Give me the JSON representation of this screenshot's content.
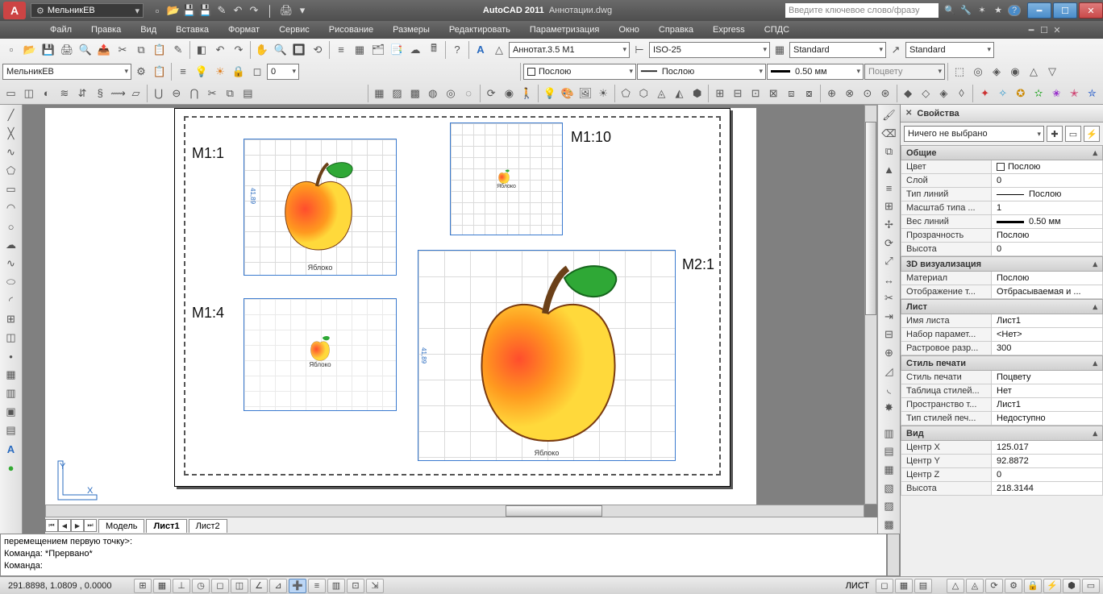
{
  "app": {
    "name": "AutoCAD 2011",
    "doc": "Аннотации.dwg",
    "workspace": "МельникЕВ",
    "search_placeholder": "Введите ключевое слово/фразу"
  },
  "menu": [
    "Файл",
    "Правка",
    "Вид",
    "Вставка",
    "Формат",
    "Сервис",
    "Рисование",
    "Размеры",
    "Редактировать",
    "Параметризация",
    "Окно",
    "Справка",
    "Express",
    "СПДС"
  ],
  "row1": {
    "layer_combo": "МельникЕВ",
    "layerstate": "0",
    "textstyle": "Аннотат.3.5 М1",
    "dimstyle": "ISO-25",
    "tablestyle": "Standard",
    "mleaderstyle": "Standard"
  },
  "row2": {
    "color": "Послою",
    "ltype": "Послою",
    "lweight": "0.50 мм",
    "plotstyle": "Поцвету"
  },
  "tabs": {
    "model": "Модель",
    "l1": "Лист1",
    "l2": "Лист2"
  },
  "scales": {
    "s1": "М1:1",
    "s2": "М1:10",
    "s3": "М1:4",
    "s4": "М2:1"
  },
  "vplabel": "Яблоко",
  "dimtext": "41,89",
  "cmd": {
    "line1": "перемещением первую точку>:",
    "line2": "Команда: *Прервано*",
    "line3": "Команда:"
  },
  "status": {
    "coords": "291.8898, 1.0809 , 0.0000",
    "layout": "ЛИСТ"
  },
  "props": {
    "title": "Свойства",
    "selection": "Ничего не выбрано",
    "groups": {
      "general": {
        "title": "Общие",
        "rows": [
          [
            "Цвет",
            "Послою"
          ],
          [
            "Слой",
            "0"
          ],
          [
            "Тип линий",
            "Послою"
          ],
          [
            "Масштаб типа ...",
            "1"
          ],
          [
            "Вес линий",
            "0.50 мм"
          ],
          [
            "Прозрачность",
            "Послою"
          ],
          [
            "Высота",
            "0"
          ]
        ]
      },
      "viz": {
        "title": "3D визуализация",
        "rows": [
          [
            "Материал",
            "Послою"
          ],
          [
            "Отображение т...",
            "Отбрасываемая и ..."
          ]
        ]
      },
      "sheet": {
        "title": "Лист",
        "rows": [
          [
            "Имя листа",
            "Лист1"
          ],
          [
            "Набор парамет...",
            "<Нет>"
          ],
          [
            "Растровое разр...",
            "300"
          ]
        ]
      },
      "plot": {
        "title": "Стиль печати",
        "rows": [
          [
            "Стиль печати",
            "Поцвету"
          ],
          [
            "Таблица стилей...",
            "Нет"
          ],
          [
            "Пространство т...",
            "Лист1"
          ],
          [
            "Тип стилей печ...",
            "Недоступно"
          ]
        ]
      },
      "view": {
        "title": "Вид",
        "rows": [
          [
            "Центр X",
            "125.017"
          ],
          [
            "Центр Y",
            "92.8872"
          ],
          [
            "Центр Z",
            "0"
          ],
          [
            "Высота",
            "218.3144"
          ]
        ]
      }
    }
  }
}
